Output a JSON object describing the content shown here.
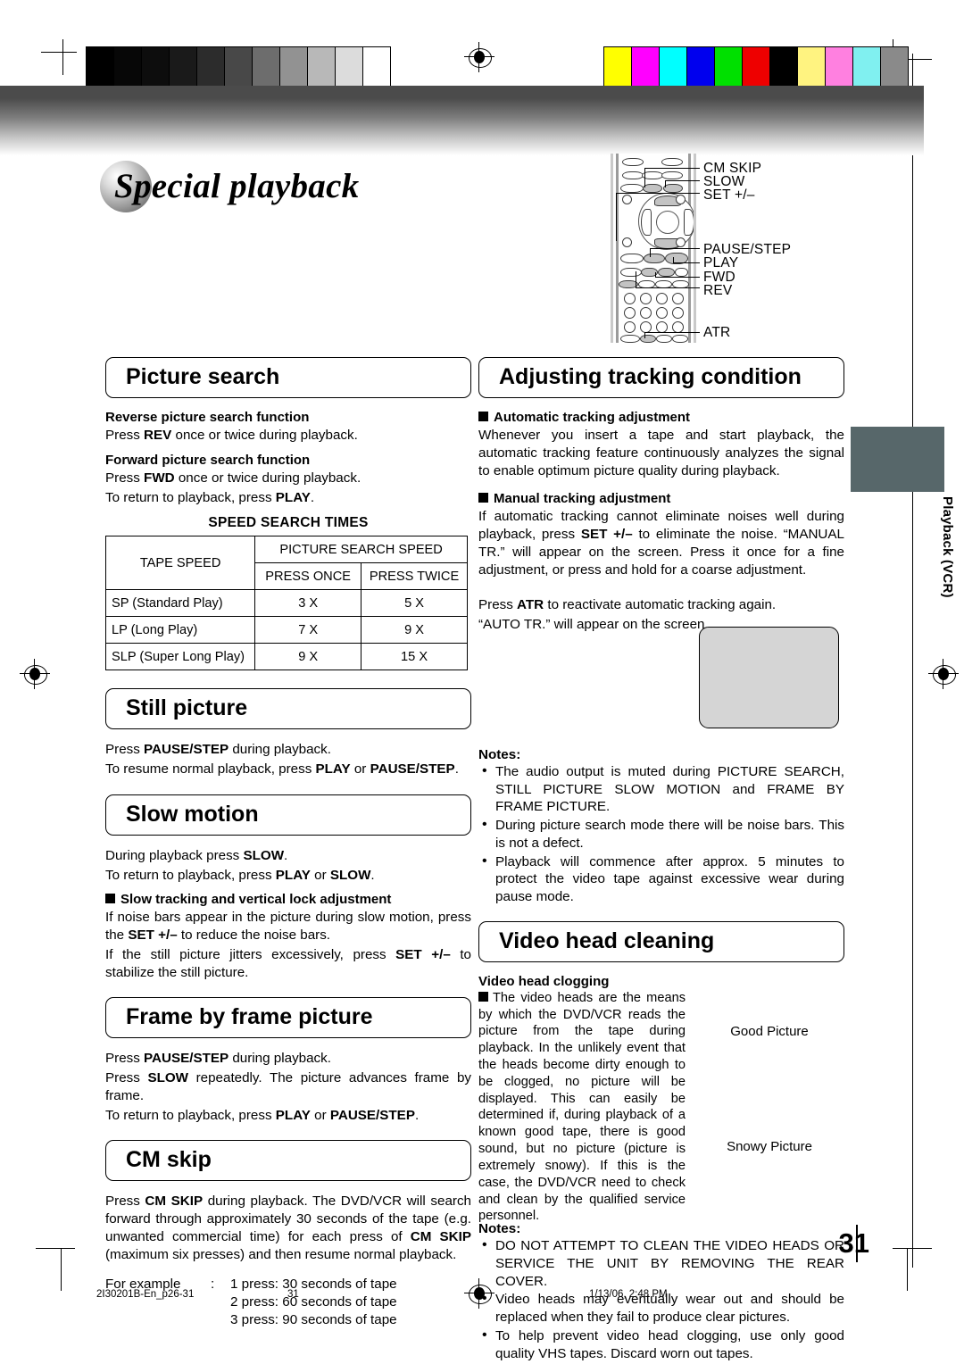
{
  "page": {
    "title": "Special playback",
    "number": "31",
    "side_tab": "Playback (VCR)"
  },
  "remote": {
    "labels": [
      "CM SKIP",
      "SLOW",
      "SET +/–",
      "PAUSE/STEP",
      "PLAY",
      "FWD",
      "REV",
      "ATR"
    ]
  },
  "picture_search": {
    "heading": "Picture search",
    "reverse_head": "Reverse picture search function",
    "reverse_line": "Press REV once or twice during playback.",
    "forward_head": "Forward picture search function",
    "forward_line1": "Press FWD once or twice during playback.",
    "forward_line2": "To return to playback, press PLAY.",
    "table_caption": "SPEED SEARCH TIMES",
    "table": {
      "col_tape": "TAPE SPEED",
      "col_group": "PICTURE SEARCH SPEED",
      "col_once": "PRESS ONCE",
      "col_twice": "PRESS TWICE",
      "rows": [
        {
          "speed": "SP (Standard Play)",
          "once": "3 X",
          "twice": "5 X"
        },
        {
          "speed": "LP (Long Play)",
          "once": "7 X",
          "twice": "9 X"
        },
        {
          "speed": "SLP (Super Long Play)",
          "once": "9 X",
          "twice": "15 X"
        }
      ]
    }
  },
  "still_picture": {
    "heading": "Still picture",
    "line1": "Press PAUSE/STEP during playback.",
    "line2": "To resume normal playback, press PLAY or PAUSE/STEP."
  },
  "slow_motion": {
    "heading": "Slow motion",
    "line1": "During playback press SLOW.",
    "line2": "To return to playback, press PLAY or SLOW.",
    "sub_head": "Slow tracking and vertical lock adjustment",
    "body1": "If noise bars appear in the picture during slow motion, press the SET +/– to reduce the noise bars.",
    "body2": "If the still picture jitters excessively, press SET +/– to stabilize the still picture."
  },
  "frame_by_frame": {
    "heading": "Frame by frame picture",
    "line1": "Press PAUSE/STEP during playback.",
    "line2": "Press SLOW repeatedly. The picture advances frame by frame.",
    "line3": "To return to playback, press PLAY or PAUSE/STEP."
  },
  "cm_skip": {
    "heading": "CM skip",
    "body": "Press CM SKIP during playback. The DVD/VCR will search forward through approximately 30 seconds of the tape (e.g. unwanted commercial time) for each press of CM SKIP (maximum six presses) and then resume normal playback.",
    "example_label": "For example",
    "example_sep": ":",
    "examples": [
      "1 press: 30 seconds of tape",
      "2 press: 60 seconds of tape",
      "3 press: 90 seconds of tape"
    ]
  },
  "tracking": {
    "heading": "Adjusting tracking condition",
    "auto_head": "Automatic tracking adjustment",
    "auto_body": "Whenever you insert a tape and start playback, the automatic tracking feature continuously analyzes the signal to enable optimum picture quality during playback.",
    "manual_head": "Manual tracking adjustment",
    "manual_body": "If automatic tracking cannot eliminate noises well during playback, press SET +/– to eliminate the noise. “MANUAL TR.” will appear on the screen. Press it once for a fine adjustment, or press and hold for a coarse adjustment.",
    "atr_line1": "Press ATR to reactivate automatic tracking again.",
    "atr_line2": "“AUTO TR.” will appear on the screen.",
    "notes_title": "Notes:",
    "notes": [
      "The audio output is muted during PICTURE SEARCH, STILL PICTURE SLOW MOTION and FRAME BY FRAME PICTURE.",
      "During picture search mode there will be noise bars. This is not a defect.",
      "Playback will commence after approx. 5 minutes to protect the video tape against excessive wear during pause mode."
    ]
  },
  "video_head_cleaning": {
    "heading": "Video head cleaning",
    "sub_head": "Video head clogging",
    "body": "The video heads are the means by which the DVD/VCR reads the picture from the tape during playback. In the unlikely event that the heads become dirty enough to be clogged, no picture will be displayed. This can easily be determined if, during playback of a known good tape, there is good sound, but no picture (picture is extremely snowy). If this is the case, the DVD/VCR need to check and clean by the qualified service personnel.",
    "pic_good": "Good Picture",
    "pic_snowy": "Snowy Picture",
    "notes_title": "Notes:",
    "notes": [
      "DO NOT ATTEMPT TO CLEAN THE VIDEO HEADS OR SERVICE THE UNIT BY REMOVING THE REAR COVER.",
      "Video heads may eventually wear out and should be replaced when they fail to produce clear pictures.",
      "To help prevent video head clogging, use only good quality VHS tapes. Discard worn out tapes."
    ]
  },
  "footer": {
    "file": "2I30201B-En_p26-31",
    "page": "31",
    "date": "1/13/06, 2:48 PM"
  },
  "calibration": {
    "gray_steps": [
      "#000000",
      "#070707",
      "#0d0d0d",
      "#1a1a1a",
      "#2c2c2c",
      "#484848",
      "#6d6d6d",
      "#929292",
      "#b8b8b8",
      "#dcdcdc",
      "#ffffff"
    ],
    "color_steps": [
      "#ffff00",
      "#ff00ff",
      "#00ffff",
      "#0000ee",
      "#00e000",
      "#ee0000",
      "#000000",
      "#fff380",
      "#ff80e0",
      "#80f0f0",
      "#8a8a8a"
    ]
  },
  "colors": {
    "side_tab": "#57676a",
    "screenshot_fill": "#d5d5d5"
  }
}
